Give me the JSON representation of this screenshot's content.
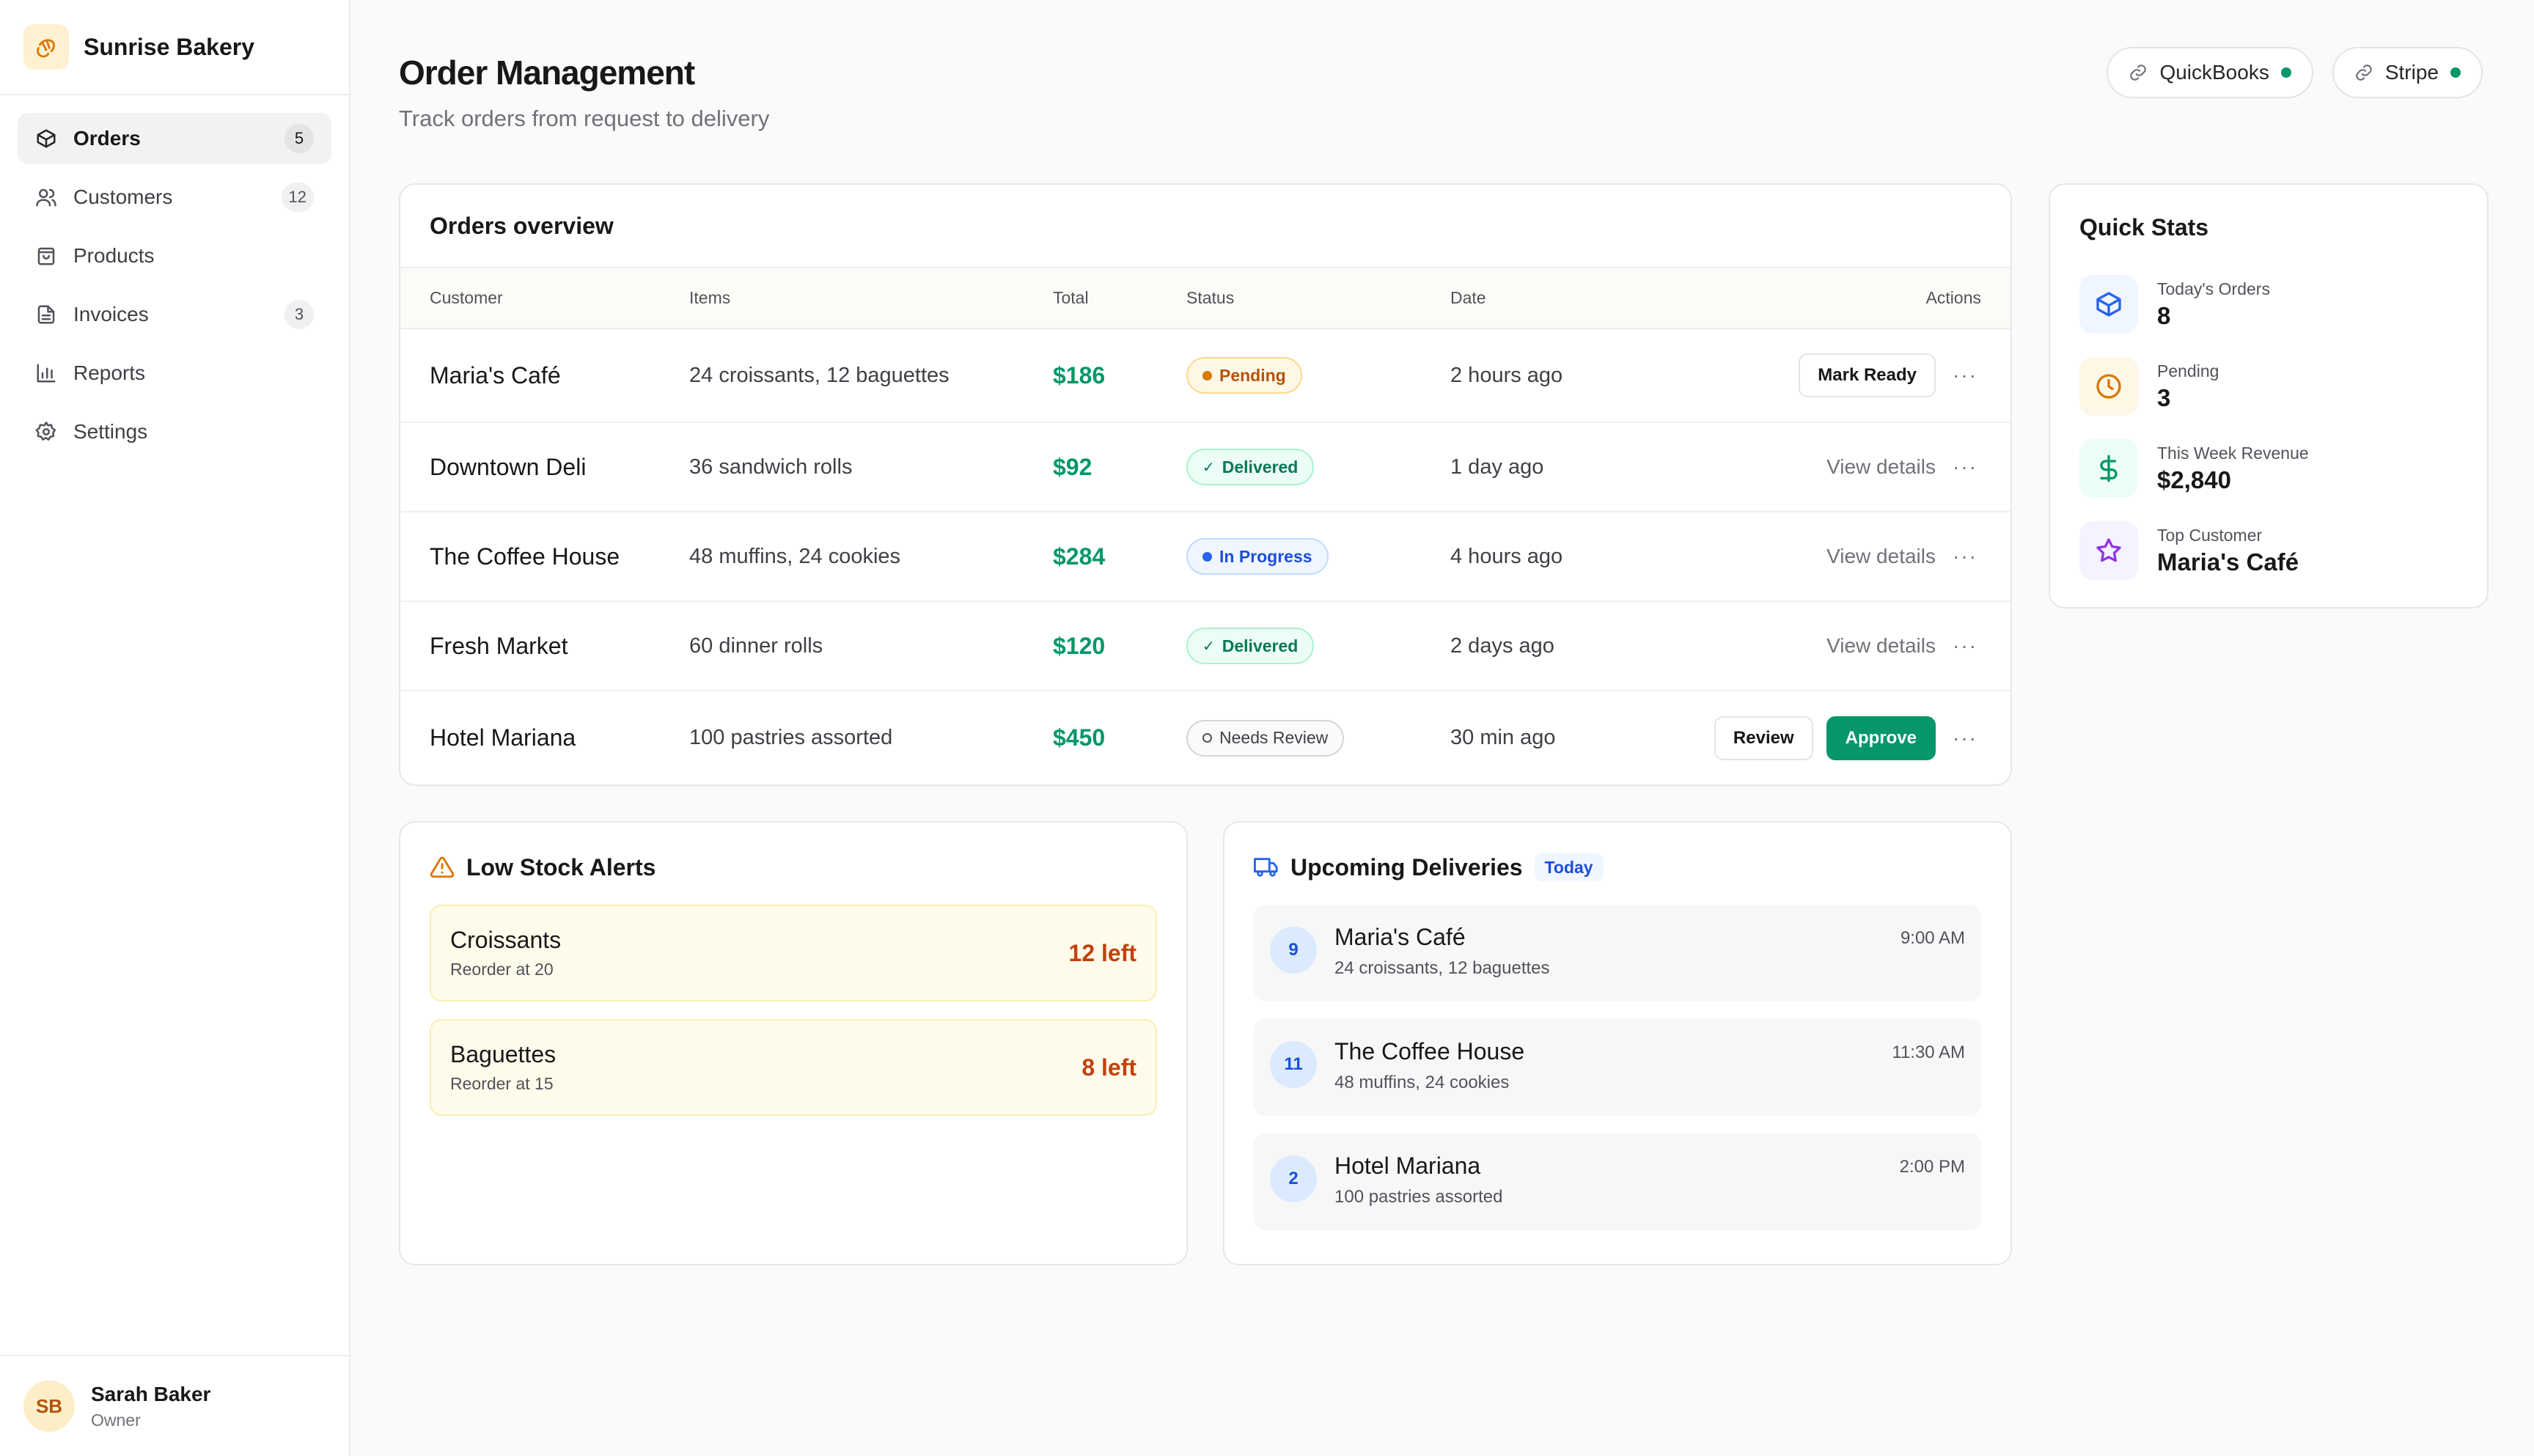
{
  "brand": {
    "name": "Sunrise Bakery"
  },
  "sidebar": {
    "items": [
      {
        "label": "Orders",
        "badge": "5",
        "icon": "box-icon",
        "active": true
      },
      {
        "label": "Customers",
        "badge": "12",
        "icon": "users-icon"
      },
      {
        "label": "Products",
        "badge": "",
        "icon": "bag-icon"
      },
      {
        "label": "Invoices",
        "badge": "3",
        "icon": "document-icon"
      },
      {
        "label": "Reports",
        "badge": "",
        "icon": "bar-chart-icon"
      },
      {
        "label": "Settings",
        "badge": "",
        "icon": "gear-icon"
      }
    ]
  },
  "user": {
    "initials": "SB",
    "name": "Sarah Baker",
    "role": "Owner"
  },
  "page": {
    "title": "Order Management",
    "subtitle": "Track orders from request to delivery"
  },
  "integrations": [
    {
      "label": "QuickBooks",
      "status_color": "#059669"
    },
    {
      "label": "Stripe",
      "status_color": "#059669"
    }
  ],
  "orders": {
    "title": "Orders overview",
    "columns": [
      "Customer",
      "Items",
      "Total",
      "Status",
      "Date",
      "Actions"
    ],
    "rows": [
      {
        "customer": "Maria's Café",
        "items": "24 croissants, 12 baguettes",
        "total": "$186",
        "status": "Pending",
        "date": "2 hours ago",
        "action": "Mark Ready"
      },
      {
        "customer": "Downtown Deli",
        "items": "36 sandwich rolls",
        "total": "$92",
        "status": "Delivered",
        "date": "1 day ago",
        "action": "View details"
      },
      {
        "customer": "The Coffee House",
        "items": "48 muffins, 24 cookies",
        "total": "$284",
        "status": "In Progress",
        "date": "4 hours ago",
        "action": "View details"
      },
      {
        "customer": "Fresh Market",
        "items": "60 dinner rolls",
        "total": "$120",
        "status": "Delivered",
        "date": "2 days ago",
        "action": "View details"
      },
      {
        "customer": "Hotel Mariana",
        "items": "100 pastries assorted",
        "total": "$450",
        "status": "Needs Review",
        "date": "30 min ago",
        "action": "Review",
        "action2": "Approve"
      }
    ]
  },
  "stats": {
    "title": "Quick Stats",
    "items": [
      {
        "label": "Today's Orders",
        "value": "8",
        "icon": "box-icon",
        "color": "#2563eb"
      },
      {
        "label": "Pending",
        "value": "3",
        "icon": "clock-icon",
        "color": "#d97706"
      },
      {
        "label": "This Week Revenue",
        "value": "$2,840",
        "icon": "dollar-icon",
        "color": "#059669"
      },
      {
        "label": "Top Customer",
        "value": "Maria's Café",
        "icon": "star-icon",
        "color": "#9333ea"
      }
    ]
  },
  "low_stock": {
    "title": "Low Stock Alerts",
    "items": [
      {
        "name": "Croissants",
        "reorder": "Reorder at 20",
        "left": "12 left"
      },
      {
        "name": "Baguettes",
        "reorder": "Reorder at 15",
        "left": "8 left"
      }
    ]
  },
  "deliveries": {
    "title": "Upcoming Deliveries",
    "chip": "Today",
    "items": [
      {
        "num": "9",
        "name": "Maria's Café",
        "items": "24 croissants, 12 baguettes",
        "time": "9:00 AM"
      },
      {
        "num": "11",
        "name": "The Coffee House",
        "items": "48 muffins, 24 cookies",
        "time": "11:30 AM"
      },
      {
        "num": "2",
        "name": "Hotel Mariana",
        "items": "100 pastries assorted",
        "time": "2:00 PM"
      }
    ]
  }
}
